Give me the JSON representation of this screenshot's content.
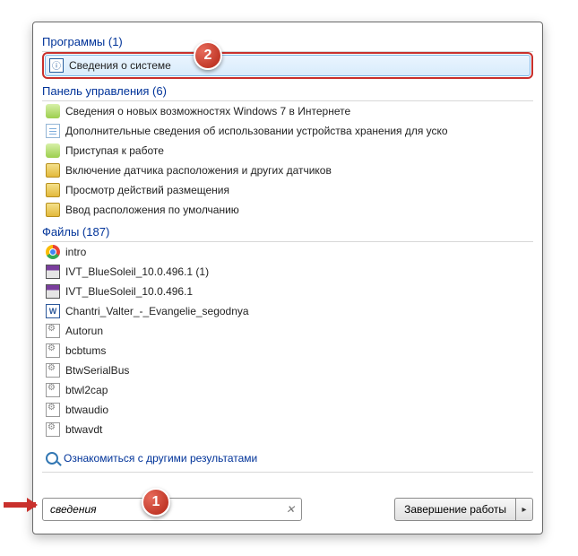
{
  "sections": {
    "programs": {
      "title_label": "Программы",
      "count": 1
    },
    "control_panel": {
      "title_label": "Панель управления",
      "count": 6
    },
    "files": {
      "title_label": "Файлы",
      "count": 187
    }
  },
  "programs_items": [
    {
      "label": "Сведения о системе"
    }
  ],
  "control_panel_items": [
    {
      "label": "Сведения о новых возможностях Windows 7 в Интернете"
    },
    {
      "label": "Дополнительные сведения об использовании устройства хранения для уско"
    },
    {
      "label": "Приступая к работе"
    },
    {
      "label": "Включение датчика расположения и других датчиков"
    },
    {
      "label": "Просмотр действий размещения"
    },
    {
      "label": "Ввод расположения по умолчанию"
    }
  ],
  "files_items": [
    {
      "label": "intro",
      "icon": "chrome"
    },
    {
      "label": "IVT_BlueSoleil_10.0.496.1 (1)",
      "icon": "rar"
    },
    {
      "label": "IVT_BlueSoleil_10.0.496.1",
      "icon": "rar"
    },
    {
      "label": "Chantri_Valter_-_Evangelie_segodnya",
      "icon": "word"
    },
    {
      "label": "Autorun",
      "icon": "inf"
    },
    {
      "label": "bcbtums",
      "icon": "inf"
    },
    {
      "label": "BtwSerialBus",
      "icon": "inf"
    },
    {
      "label": "btwl2cap",
      "icon": "inf"
    },
    {
      "label": "btwaudio",
      "icon": "inf"
    },
    {
      "label": "btwavdt",
      "icon": "inf"
    }
  ],
  "more_results_label": "Ознакомиться с другими результатами",
  "search": {
    "value": "сведения"
  },
  "shutdown": {
    "label": "Завершение работы"
  },
  "callouts": {
    "one": "1",
    "two": "2"
  }
}
